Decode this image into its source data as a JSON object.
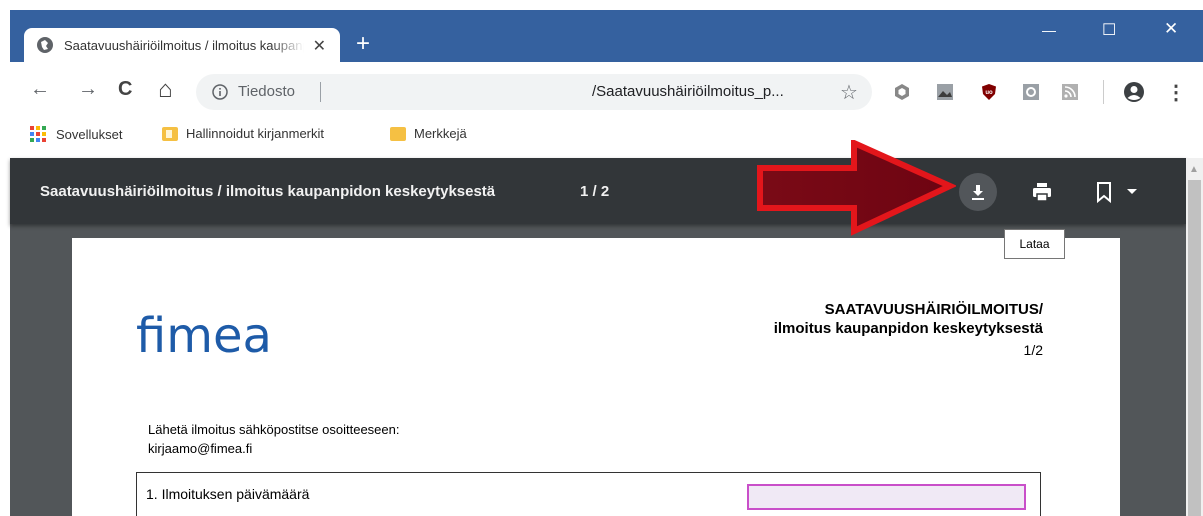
{
  "browser": {
    "tab_title": "Saatavuushäiriöilmoitus / ilmoitus kaupanpidon keskeytyksestä",
    "tab_close": "✕",
    "new_tab": "+",
    "window_controls": {
      "minimize": "—",
      "maximize": "☐",
      "close": "✕"
    },
    "nav": {
      "back": "←",
      "forward": "→",
      "reload": "C",
      "home": "⌂"
    },
    "omnibox": {
      "label": "Tiedosto",
      "url": "/Saatavuushäiriöilmoitus_p..."
    },
    "star": "☆",
    "menu": "⋮"
  },
  "bookmarks": {
    "apps": "Sovellukset",
    "items": [
      "Hallinnoidut kirjanmerkit",
      "Merkkejä"
    ]
  },
  "pdf": {
    "title": "Saatavuushäiriöilmoitus / ilmoitus kaupanpidon keskeytyksestä",
    "pages": "1 / 2",
    "tooltip": "Lataa"
  },
  "document": {
    "logo_text": "fimea",
    "heading_line1": "SAATAVUUSHÄIRIÖILMOITUS/",
    "heading_line2": "ilmoitus kaupanpidon keskeytyksestä",
    "page_number": "1/2",
    "note_line1": "Lähetä ilmoitus sähköpostitse osoitteeseen:",
    "note_line2": "kirjaamo@fimea.fi",
    "field_label": "1. Ilmoituksen päivämäärä"
  },
  "colors": {
    "titlebar": "#35619f",
    "pdf_toolbar": "#323639",
    "pdf_bg": "#525659",
    "arrow_red": "#e3161b",
    "arrow_dark": "#7a0a16",
    "fimea_blue": "#1e5ba8",
    "field_border": "#c94fc9"
  }
}
